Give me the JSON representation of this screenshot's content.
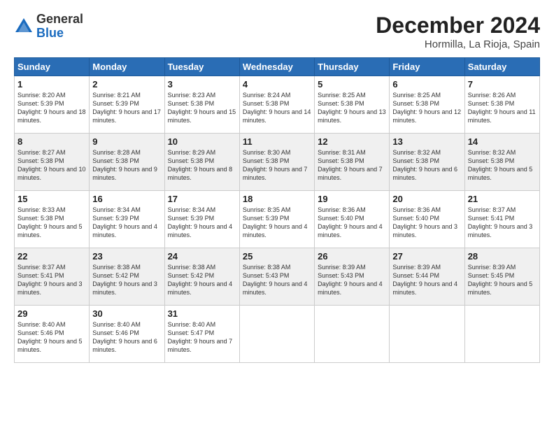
{
  "logo": {
    "general": "General",
    "blue": "Blue"
  },
  "title": "December 2024",
  "location": "Hormilla, La Rioja, Spain",
  "headers": [
    "Sunday",
    "Monday",
    "Tuesday",
    "Wednesday",
    "Thursday",
    "Friday",
    "Saturday"
  ],
  "rows": [
    [
      {
        "day": "1",
        "sunrise": "Sunrise: 8:20 AM",
        "sunset": "Sunset: 5:39 PM",
        "daylight": "Daylight: 9 hours and 18 minutes."
      },
      {
        "day": "2",
        "sunrise": "Sunrise: 8:21 AM",
        "sunset": "Sunset: 5:39 PM",
        "daylight": "Daylight: 9 hours and 17 minutes."
      },
      {
        "day": "3",
        "sunrise": "Sunrise: 8:23 AM",
        "sunset": "Sunset: 5:38 PM",
        "daylight": "Daylight: 9 hours and 15 minutes."
      },
      {
        "day": "4",
        "sunrise": "Sunrise: 8:24 AM",
        "sunset": "Sunset: 5:38 PM",
        "daylight": "Daylight: 9 hours and 14 minutes."
      },
      {
        "day": "5",
        "sunrise": "Sunrise: 8:25 AM",
        "sunset": "Sunset: 5:38 PM",
        "daylight": "Daylight: 9 hours and 13 minutes."
      },
      {
        "day": "6",
        "sunrise": "Sunrise: 8:25 AM",
        "sunset": "Sunset: 5:38 PM",
        "daylight": "Daylight: 9 hours and 12 minutes."
      },
      {
        "day": "7",
        "sunrise": "Sunrise: 8:26 AM",
        "sunset": "Sunset: 5:38 PM",
        "daylight": "Daylight: 9 hours and 11 minutes."
      }
    ],
    [
      {
        "day": "8",
        "sunrise": "Sunrise: 8:27 AM",
        "sunset": "Sunset: 5:38 PM",
        "daylight": "Daylight: 9 hours and 10 minutes."
      },
      {
        "day": "9",
        "sunrise": "Sunrise: 8:28 AM",
        "sunset": "Sunset: 5:38 PM",
        "daylight": "Daylight: 9 hours and 9 minutes."
      },
      {
        "day": "10",
        "sunrise": "Sunrise: 8:29 AM",
        "sunset": "Sunset: 5:38 PM",
        "daylight": "Daylight: 9 hours and 8 minutes."
      },
      {
        "day": "11",
        "sunrise": "Sunrise: 8:30 AM",
        "sunset": "Sunset: 5:38 PM",
        "daylight": "Daylight: 9 hours and 7 minutes."
      },
      {
        "day": "12",
        "sunrise": "Sunrise: 8:31 AM",
        "sunset": "Sunset: 5:38 PM",
        "daylight": "Daylight: 9 hours and 7 minutes."
      },
      {
        "day": "13",
        "sunrise": "Sunrise: 8:32 AM",
        "sunset": "Sunset: 5:38 PM",
        "daylight": "Daylight: 9 hours and 6 minutes."
      },
      {
        "day": "14",
        "sunrise": "Sunrise: 8:32 AM",
        "sunset": "Sunset: 5:38 PM",
        "daylight": "Daylight: 9 hours and 5 minutes."
      }
    ],
    [
      {
        "day": "15",
        "sunrise": "Sunrise: 8:33 AM",
        "sunset": "Sunset: 5:38 PM",
        "daylight": "Daylight: 9 hours and 5 minutes."
      },
      {
        "day": "16",
        "sunrise": "Sunrise: 8:34 AM",
        "sunset": "Sunset: 5:39 PM",
        "daylight": "Daylight: 9 hours and 4 minutes."
      },
      {
        "day": "17",
        "sunrise": "Sunrise: 8:34 AM",
        "sunset": "Sunset: 5:39 PM",
        "daylight": "Daylight: 9 hours and 4 minutes."
      },
      {
        "day": "18",
        "sunrise": "Sunrise: 8:35 AM",
        "sunset": "Sunset: 5:39 PM",
        "daylight": "Daylight: 9 hours and 4 minutes."
      },
      {
        "day": "19",
        "sunrise": "Sunrise: 8:36 AM",
        "sunset": "Sunset: 5:40 PM",
        "daylight": "Daylight: 9 hours and 4 minutes."
      },
      {
        "day": "20",
        "sunrise": "Sunrise: 8:36 AM",
        "sunset": "Sunset: 5:40 PM",
        "daylight": "Daylight: 9 hours and 3 minutes."
      },
      {
        "day": "21",
        "sunrise": "Sunrise: 8:37 AM",
        "sunset": "Sunset: 5:41 PM",
        "daylight": "Daylight: 9 hours and 3 minutes."
      }
    ],
    [
      {
        "day": "22",
        "sunrise": "Sunrise: 8:37 AM",
        "sunset": "Sunset: 5:41 PM",
        "daylight": "Daylight: 9 hours and 3 minutes."
      },
      {
        "day": "23",
        "sunrise": "Sunrise: 8:38 AM",
        "sunset": "Sunset: 5:42 PM",
        "daylight": "Daylight: 9 hours and 3 minutes."
      },
      {
        "day": "24",
        "sunrise": "Sunrise: 8:38 AM",
        "sunset": "Sunset: 5:42 PM",
        "daylight": "Daylight: 9 hours and 4 minutes."
      },
      {
        "day": "25",
        "sunrise": "Sunrise: 8:38 AM",
        "sunset": "Sunset: 5:43 PM",
        "daylight": "Daylight: 9 hours and 4 minutes."
      },
      {
        "day": "26",
        "sunrise": "Sunrise: 8:39 AM",
        "sunset": "Sunset: 5:43 PM",
        "daylight": "Daylight: 9 hours and 4 minutes."
      },
      {
        "day": "27",
        "sunrise": "Sunrise: 8:39 AM",
        "sunset": "Sunset: 5:44 PM",
        "daylight": "Daylight: 9 hours and 4 minutes."
      },
      {
        "day": "28",
        "sunrise": "Sunrise: 8:39 AM",
        "sunset": "Sunset: 5:45 PM",
        "daylight": "Daylight: 9 hours and 5 minutes."
      }
    ],
    [
      {
        "day": "29",
        "sunrise": "Sunrise: 8:40 AM",
        "sunset": "Sunset: 5:46 PM",
        "daylight": "Daylight: 9 hours and 5 minutes."
      },
      {
        "day": "30",
        "sunrise": "Sunrise: 8:40 AM",
        "sunset": "Sunset: 5:46 PM",
        "daylight": "Daylight: 9 hours and 6 minutes."
      },
      {
        "day": "31",
        "sunrise": "Sunrise: 8:40 AM",
        "sunset": "Sunset: 5:47 PM",
        "daylight": "Daylight: 9 hours and 7 minutes."
      },
      null,
      null,
      null,
      null
    ]
  ],
  "shaded_rows": [
    1,
    3
  ]
}
